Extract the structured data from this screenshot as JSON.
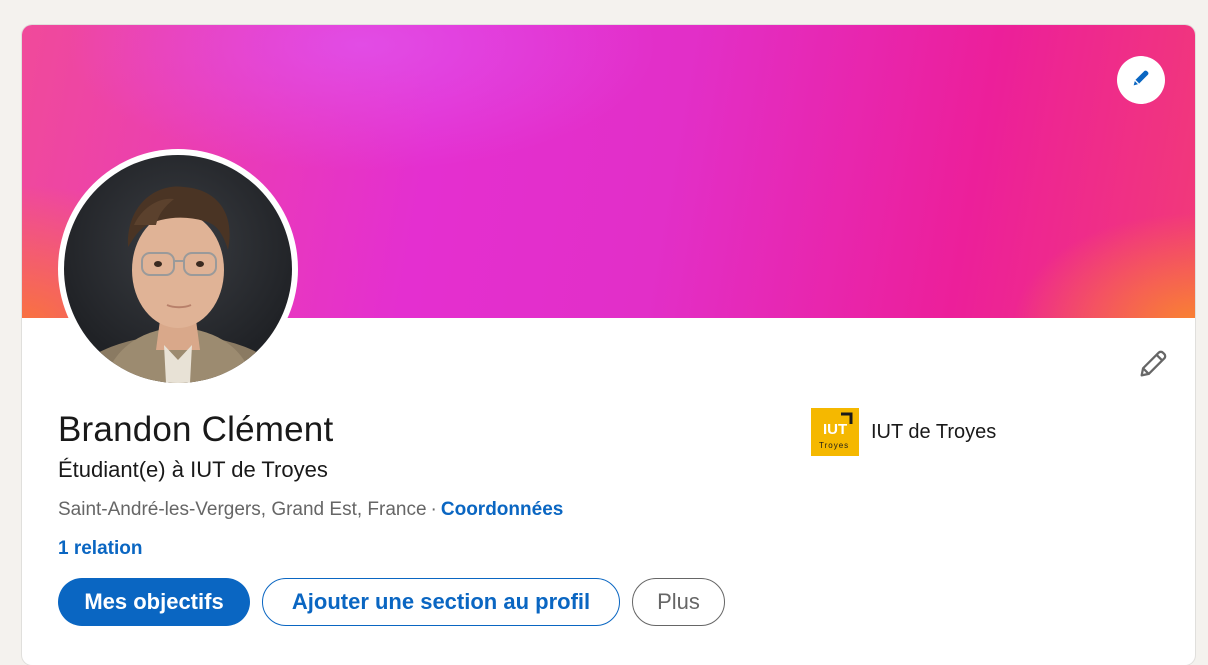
{
  "profile": {
    "name": "Brandon Clément",
    "headline": "Étudiant(e) à IUT de Troyes",
    "location": "Saint-André-les-Vergers, Grand Est, France",
    "separator": "·",
    "contact_link": "Coordonnées",
    "connections": "1 relation"
  },
  "actions": {
    "primary": "Mes objectifs",
    "add_section": "Ajouter une section au profil",
    "more": "Plus"
  },
  "school": {
    "name": "IUT de Troyes",
    "logo_text": "IUT",
    "logo_subtext": "Troyes"
  },
  "colors": {
    "accent": "#0a66c2",
    "school_logo": "#f5b800",
    "page_background": "#f4f2ee"
  },
  "icons": {
    "banner_edit": "pencil-icon",
    "intro_edit": "pencil-icon"
  }
}
